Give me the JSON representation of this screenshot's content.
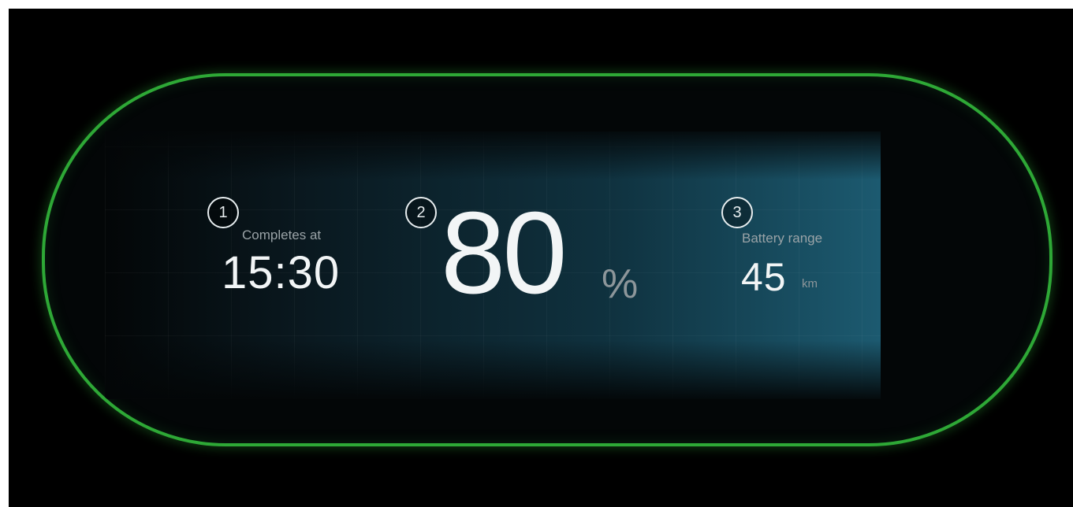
{
  "markers": {
    "one": "1",
    "two": "2",
    "three": "3"
  },
  "completion": {
    "label": "Completes at",
    "time": "15:30"
  },
  "charge": {
    "value": "80",
    "unit": "%",
    "level_percent": 80
  },
  "range": {
    "label": "Battery range",
    "value": "45",
    "unit": "km"
  },
  "colors": {
    "accent_ring": "#2ea836",
    "background": "#000000",
    "panel_glow": "#1c5a70",
    "primary_text": "#f2f5f6",
    "secondary_text": "#9aa3a7"
  }
}
